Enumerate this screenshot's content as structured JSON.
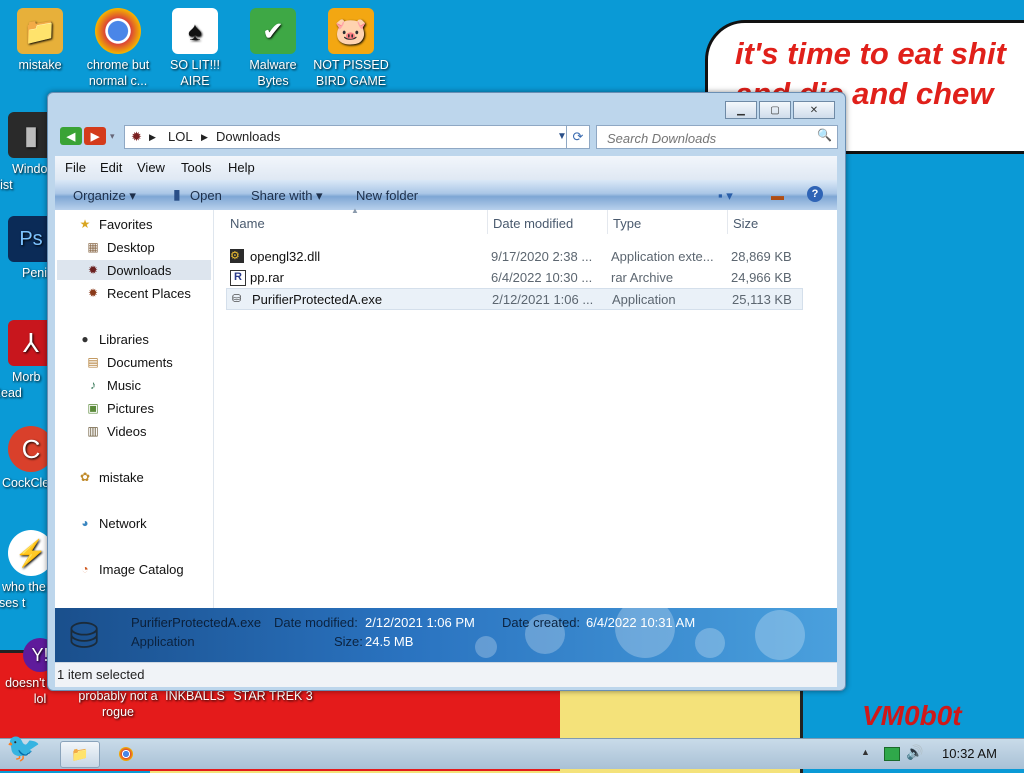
{
  "desktop": {
    "speech_text": "it's time to eat shit and die and chew gum",
    "watermark": "VM0b0t",
    "icons": [
      {
        "label": "mistake",
        "icon": "folder-icon"
      },
      {
        "label": "chrome but normal c...",
        "icon": "chrome-icon"
      },
      {
        "label": "SO LIT!!! AIRE",
        "icon": "solitaire-icon"
      },
      {
        "label": "Malware Bytes",
        "icon": "shield-icon"
      },
      {
        "label": "NOT PISSED BIRD GAME",
        "icon": "pig-icon"
      },
      {
        "label": "Windo Vist",
        "icon": "bin-icon"
      },
      {
        "label": "Peni",
        "icon": "photoshop-icon"
      },
      {
        "label": "Morb Read",
        "icon": "acrobat-icon"
      },
      {
        "label": "CockCle",
        "icon": "ccleaner-icon"
      },
      {
        "label": "who the uses t",
        "icon": "lightning-icon"
      },
      {
        "label": "doesn't work lol",
        "icon": "yahoo-icon"
      },
      {
        "label": "probably not a rogue",
        "icon": "shortcut-icon"
      },
      {
        "label": "INKBALLS",
        "icon": "game-icon"
      },
      {
        "label": "STAR TREK 3",
        "icon": "game-icon"
      }
    ]
  },
  "window": {
    "breadcrumb": [
      "LOL",
      "Downloads"
    ],
    "search_placeholder": "Search Downloads",
    "menu": [
      "File",
      "Edit",
      "View",
      "Tools",
      "Help"
    ],
    "toolbar": {
      "organize": "Organize ▾",
      "open": "Open",
      "share": "Share with ▾",
      "new_folder": "New folder"
    },
    "nav": {
      "favorites": "Favorites",
      "desktop": "Desktop",
      "downloads": "Downloads",
      "recent": "Recent Places",
      "libraries": "Libraries",
      "documents": "Documents",
      "music": "Music",
      "pictures": "Pictures",
      "videos": "Videos",
      "mistake": "mistake",
      "network": "Network",
      "image_catalog": "Image Catalog"
    },
    "columns": [
      "Name",
      "Date modified",
      "Type",
      "Size"
    ],
    "files": [
      {
        "name": "opengl32.dll",
        "date": "9/17/2020 2:38 ...",
        "type": "Application exte...",
        "size": "28,869 KB"
      },
      {
        "name": "pp.rar",
        "date": "6/4/2022 10:30 ...",
        "type": "rar Archive",
        "size": "24,966 KB"
      },
      {
        "name": "PurifierProtectedA.exe",
        "date": "2/12/2021 1:06 ...",
        "type": "Application",
        "size": "25,113 KB"
      }
    ],
    "details": {
      "filename": "PurifierProtectedA.exe",
      "kind": "Application",
      "modified_label": "Date modified:",
      "modified_value": "2/12/2021 1:06 PM",
      "created_label": "Date created:",
      "created_value": "6/4/2022 10:31 AM",
      "size_label": "Size:",
      "size_value": "24.5 MB"
    },
    "status": "1 item selected"
  },
  "taskbar": {
    "clock": "10:32 AM",
    "tray_arrow": "▲"
  }
}
